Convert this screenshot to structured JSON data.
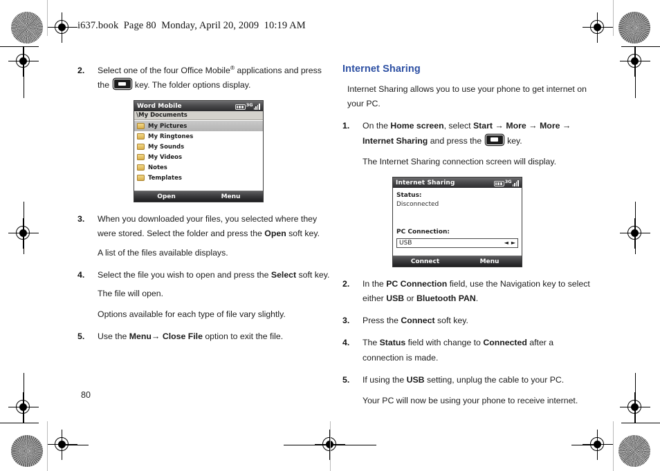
{
  "page": {
    "header": "i637.book  Page 80  Monday, April 20, 2009  10:19 AM",
    "folio": "80",
    "accent_color": "#2b4ea2",
    "text_color": "#1a1a1a"
  },
  "left_column": {
    "steps": [
      {
        "num": "2.",
        "line1_a": "Select one of the four Office Mobile",
        "line1_sup": "®",
        "line1_b": " applications and",
        "line2_a": "press the ",
        "key_icon": "ok-center-key",
        "line2_b": " key. The folder options display."
      },
      {
        "num": "3.",
        "text_a": "When you downloaded your files, you selected where they were stored. Select the folder and press the ",
        "bold1": "Open",
        "text_b": " soft key.",
        "sub": "A list of the files available displays."
      },
      {
        "num": "4.",
        "text_a": "Select the file you wish to open and press the ",
        "bold1": "Select",
        "text_b": " soft key.",
        "sub1": "The file will open.",
        "sub2": "Options available for each type of file vary slightly."
      },
      {
        "num": "5.",
        "text_a": "Use the ",
        "bold1": "Menu",
        "arrow": "→",
        "bold2": "Close File",
        "text_b": " option to exit the file."
      }
    ],
    "screenshot": {
      "title": "Word Mobile",
      "path": "\\My Documents",
      "status_icons": [
        "battery-icon",
        "3g-icon",
        "signal-icon"
      ],
      "badge_3g": "3G",
      "items": [
        {
          "label": "My Pictures",
          "icon": "folder-icon",
          "selected": true
        },
        {
          "label": "My Ringtones",
          "icon": "folder-icon",
          "selected": false
        },
        {
          "label": "My Sounds",
          "icon": "folder-icon",
          "selected": false
        },
        {
          "label": "My Videos",
          "icon": "folder-icon",
          "selected": false
        },
        {
          "label": "Notes",
          "icon": "folder-icon",
          "selected": false
        },
        {
          "label": "Templates",
          "icon": "folder-icon",
          "selected": false
        }
      ],
      "softkey_left": "Open",
      "softkey_right": "Menu"
    }
  },
  "right_column": {
    "section_title": "Internet Sharing",
    "intro": "Internet Sharing allows you to use your phone to get internet on your PC.",
    "steps": [
      {
        "num": "1.",
        "text_a": "On the ",
        "bold1": "Home screen",
        "text_b": ", select ",
        "bold2": "Start",
        "arrow1": "→",
        "bold3": "More",
        "arrow2": "→",
        "bold4": "More",
        "arrow3": "→",
        "bold5": "Internet Sharing",
        "text_c": " and press the ",
        "key_icon": "ok-center-key",
        "text_d": " key.",
        "sub": "The Internet Sharing connection screen will display."
      },
      {
        "num": "2.",
        "text_a": "In the ",
        "bold1": "PC Connection",
        "text_b": " field, use the Navigation key to select either ",
        "bold2": "USB",
        "text_c": " or ",
        "bold3": "Bluetooth PAN",
        "text_d": "."
      },
      {
        "num": "3.",
        "text_a": "Press the ",
        "bold1": "Connect",
        "text_b": " soft key."
      },
      {
        "num": "4.",
        "text_a": "The ",
        "bold1": "Status",
        "text_b": " field with change to ",
        "bold2": "Connected",
        "text_c": " after a connection is made."
      },
      {
        "num": "5.",
        "text_a": "If using the ",
        "bold1": "USB",
        "text_b": " setting, unplug the cable to your PC.",
        "sub": "Your PC will now be using your phone to receive internet."
      }
    ],
    "screenshot": {
      "title": "Internet Sharing",
      "status_icons": [
        "battery-icon",
        "3g-icon",
        "signal-icon"
      ],
      "badge_3g": "3G",
      "status_label": "Status:",
      "status_value": "Disconnected",
      "connection_label": "PC Connection:",
      "connection_value": "USB",
      "spinner_left": "◄",
      "spinner_right": "►",
      "softkey_left": "Connect",
      "softkey_right": "Menu"
    }
  }
}
